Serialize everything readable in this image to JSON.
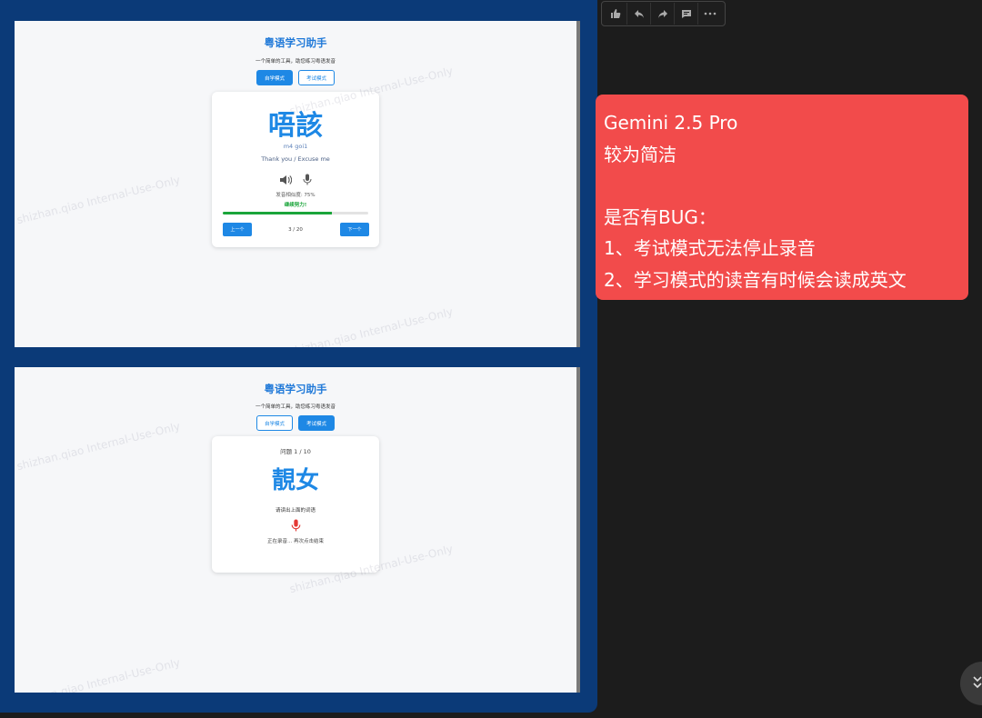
{
  "app": {
    "title": "粤语学习助手",
    "subtitle": "一个简单的工具，助您练习粤语发音",
    "mode_study": "自学模式",
    "mode_exam": "考试模式"
  },
  "study_view": {
    "word": "唔該",
    "jyutping": "m4 goi1",
    "meaning": "Thank you / Excuse me",
    "accuracy_label": "发音相似度: 75%",
    "accuracy_value": 0.75,
    "encouragement": "继续努力!",
    "prev_label": "上一个",
    "next_label": "下一个",
    "counter": "3 / 20"
  },
  "exam_view": {
    "question_counter": "问题 1 / 10",
    "word": "靚女",
    "instruction": "请读出上面的词语",
    "recording_status": "正在录音... 再次点击结束"
  },
  "toolbar": {
    "icons": [
      "thumbs-up-icon",
      "reply-icon",
      "forward-icon",
      "comment-icon",
      "more-icon"
    ]
  },
  "note": {
    "lines": [
      "Gemini 2.5 Pro",
      "较为简洁",
      "",
      "是否有BUG：",
      "1、考试模式无法停止录音",
      "2、学习模式的读音有时候会读成英文"
    ]
  },
  "watermark_text": "shizhan.qiao Internal-Use-Only",
  "colors": {
    "accent": "#1e88e5",
    "success": "#1aa53a",
    "note_bg": "#f24b4b",
    "frame": "#0b3a78",
    "mic_recording": "#e53935"
  }
}
